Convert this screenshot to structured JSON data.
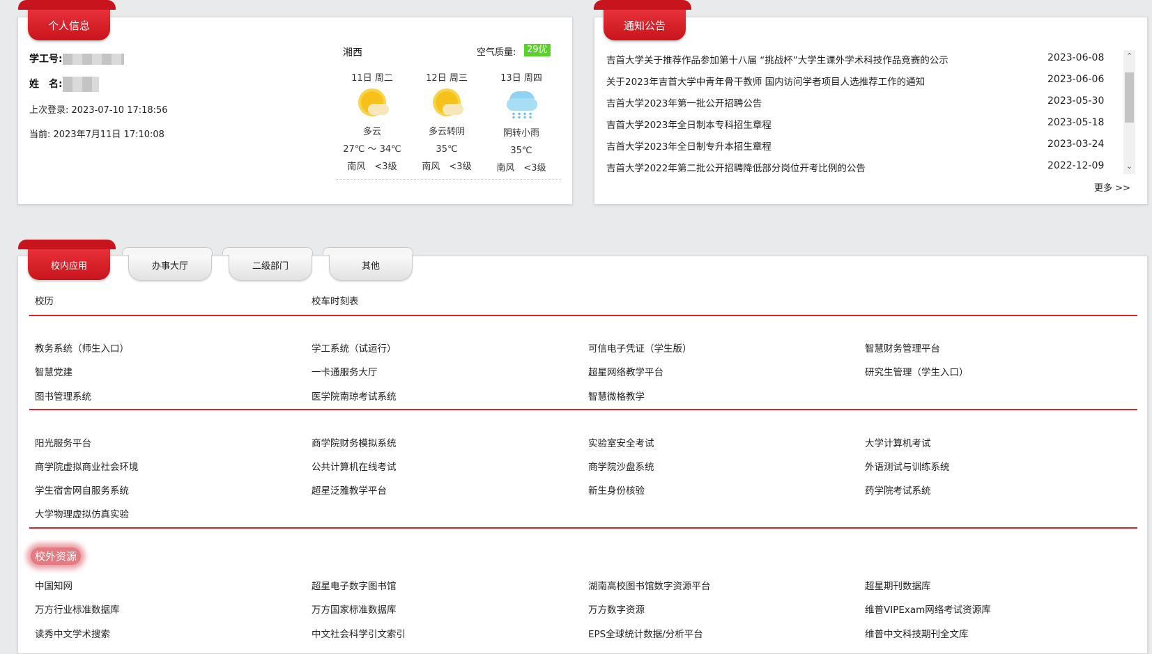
{
  "profile": {
    "title": "个人信息",
    "id_label": "学工号:",
    "name_label": "姓　名:",
    "last_login": "上次登录: 2023-07-10 17:18:56",
    "current": "当前: 2023年7月11日 17:10:08"
  },
  "weather": {
    "city": "湘西",
    "aqi_label": "空气质量:",
    "aqi_value": "29优",
    "days": [
      {
        "date": "11日 周二",
        "desc": "多云",
        "temp": "27℃ ～ 34℃",
        "wind": "南风　<3级",
        "icon": "partly-cloudy-icon"
      },
      {
        "date": "12日 周三",
        "desc": "多云转阴",
        "temp": "35℃",
        "wind": "南风　<3级",
        "icon": "partly-cloudy-icon"
      },
      {
        "date": "13日 周四",
        "desc": "阴转小雨",
        "temp": "35℃",
        "wind": "南风　<3级",
        "icon": "light-rain-icon"
      }
    ]
  },
  "notices": {
    "title": "通知公告",
    "items": [
      {
        "title": "吉首大学关于推荐作品参加第十八届 “挑战杯”大学生课外学术科技作品竞赛的公示",
        "date": "2023-06-08"
      },
      {
        "title": "关于2023年吉首大学中青年骨干教师 国内访问学者项目人选推荐工作的通知",
        "date": "2023-06-06"
      },
      {
        "title": "吉首大学2023年第一批公开招聘公告",
        "date": "2023-05-30"
      },
      {
        "title": "吉首大学2023年全日制本专科招生章程",
        "date": "2023-05-18"
      },
      {
        "title": "吉首大学2023年全日制专升本招生章程",
        "date": "2023-03-24"
      },
      {
        "title": "吉首大学2022年第二批公开招聘降低部分岗位开考比例的公告",
        "date": "2022-12-09"
      }
    ],
    "more": "更多 >>"
  },
  "apps": {
    "tabs": [
      "校内应用",
      "办事大厅",
      "二级部门",
      "其他"
    ],
    "group1": [
      "校历",
      "校车时刻表"
    ],
    "group2": [
      "教务系统（师生入口）",
      "学工系统（试运行）",
      "可信电子凭证（学生版）",
      "智慧财务管理平台",
      "智慧党建",
      "一卡通服务大厅",
      "超星网络教学平台",
      "研究生管理（学生入口）",
      "图书管理系统",
      "医学院南琼考试系统",
      "智慧微格教学"
    ],
    "group3": [
      "阳光服务平台",
      "商学院财务模拟系统",
      "实验室安全考试",
      "大学计算机考试",
      "商学院虚拟商业社会环境",
      "公共计算机在线考试",
      "商学院沙盘系统",
      "外语测试与训练系统",
      "学生宿舍网自服务系统",
      "超星泛雅教学平台",
      "新生身份核验",
      "药学院考试系统",
      "大学物理虚拟仿真实验"
    ],
    "external_title": "校外资源",
    "external": [
      "中国知网",
      "超星电子数字图书馆",
      "湖南高校图书馆数字资源平台",
      "超星期刊数据库",
      "万方行业标准数据库",
      "万方国家标准数据库",
      "万方数字资源",
      "维普VIPExam网络考试资源库",
      "读秀中文学术搜索",
      "中文社会科学引文索引",
      "EPS全球统计数据/分析平台",
      "维普中文科技期刊全文库"
    ]
  }
}
